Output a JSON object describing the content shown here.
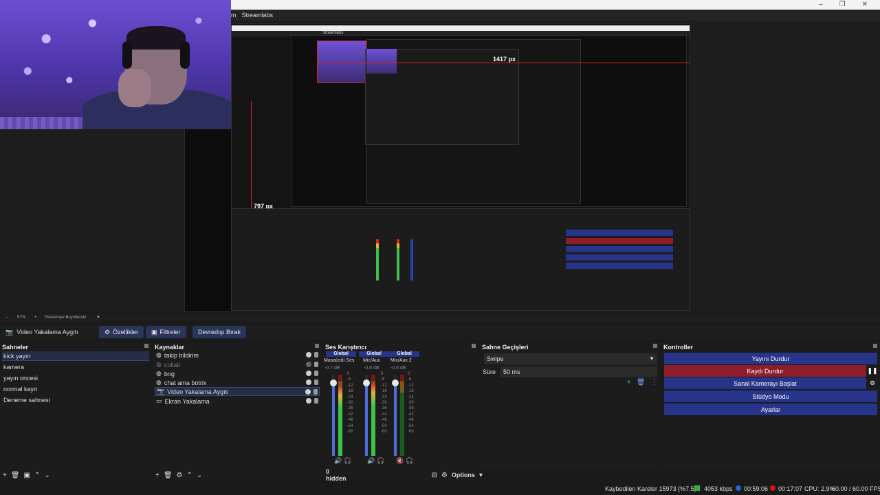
{
  "window": {
    "menu_items": [
      "m",
      "Streamlabs"
    ],
    "controls": [
      "–",
      "❐",
      "✕"
    ]
  },
  "preview": {
    "label_width": "1417 px",
    "label_height": "797 px",
    "nested_menu": "Streamlabs"
  },
  "zoombar": {
    "minus": "–",
    "zoom": "57%",
    "plus": "+",
    "fit": "Pencereye Boyutlandır",
    "caret": "▼"
  },
  "source_toolbar": {
    "source_name": "Video Yakalama Aygıtı",
    "properties": "Özellikler",
    "filters": "Filtreler",
    "deactivate": "Devredışı Bırak"
  },
  "scenes": {
    "title": "Sahneler",
    "items": [
      "kick yayın",
      "kamera",
      "yayın oncesi",
      "normal kayıt",
      "Deneme sahnesi"
    ],
    "active_index": 0
  },
  "sources": {
    "title": "Kaynaklar",
    "items": [
      {
        "label": "takip bildirim",
        "icon": "globe-icon"
      },
      {
        "label": "collab",
        "icon": "globe-icon"
      },
      {
        "label": "bng",
        "icon": "globe-icon"
      },
      {
        "label": "chat ama botrix",
        "icon": "globe-icon"
      },
      {
        "label": "Video Yakalama Aygıtı",
        "icon": "camera-icon"
      },
      {
        "label": "Ekran Yakalama",
        "icon": "monitor-icon"
      }
    ]
  },
  "mixer": {
    "title": "Ses Karıştırıcı",
    "channels": [
      {
        "tab": "Global",
        "name": "Masaüstü Ses",
        "db": "-0.7 dB",
        "fader": 0.9,
        "level": 0.85
      },
      {
        "tab": "Global",
        "name": "Mic/Aux",
        "db": "-0.8 dB",
        "fader": 0.9,
        "level": 0.88
      },
      {
        "tab": "Global",
        "name": "Mic/Aux 2",
        "db": "-0.8 dB",
        "fader": 0.9,
        "level": 0.0
      }
    ],
    "scale": [
      "0",
      "-6",
      "-12",
      "-18",
      "-24",
      "-30",
      "-36",
      "-42",
      "-48",
      "-54",
      "-60"
    ],
    "hidden": "0 hidden",
    "options": "Options"
  },
  "transitions": {
    "title": "Sahne Geçişleri",
    "selected": "Swipe",
    "duration_label": "Süre",
    "duration_value": "50 ms"
  },
  "controls": {
    "title": "Kontroller",
    "stop_stream": "Yayını Durdur",
    "stop_recording": "Kaydı Durdur",
    "start_vcam": "Sanal Kamerayı Başlat",
    "studio_mode": "Stüdyo Modu",
    "settings": "Ayarlar"
  },
  "status": {
    "dropped": "Kaybedilen Kareler 15973 (%7.5)",
    "bitrate": "4053 kbps",
    "stream_time": "00:59:06",
    "rec_time": "00:17:07",
    "cpu": "CPU: 2.9%",
    "fps": "60.00 / 60.00 FPS"
  },
  "colors": {
    "accent_blue": "#26348a",
    "record_red": "#8e1d2c",
    "meter_green": "#3cc24b"
  }
}
